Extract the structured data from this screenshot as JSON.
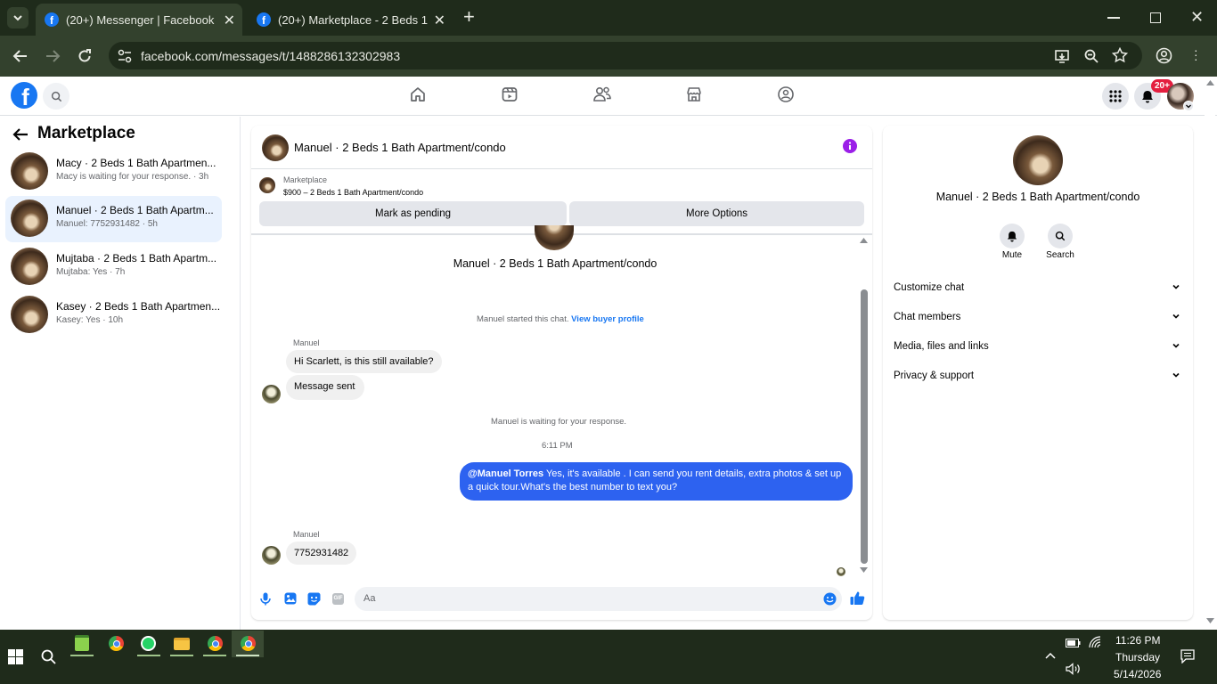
{
  "browser": {
    "tabs": [
      {
        "title": "(20+) Messenger | Facebook",
        "active": true
      },
      {
        "title": "(20+) Marketplace - 2 Beds 1 Ba",
        "active": false
      }
    ],
    "url": "facebook.com/messages/t/1488286132302983"
  },
  "fb_header": {
    "notification_badge": "20+"
  },
  "sidebar": {
    "title": "Marketplace",
    "conversations": [
      {
        "name": "Macy · 2 Beds 1 Bath Apartmen...",
        "preview": "Macy is waiting for your response. · 3h",
        "selected": false
      },
      {
        "name": "Manuel · 2 Beds 1 Bath Apartm...",
        "preview": "Manuel: 7752931482 · 5h",
        "selected": true
      },
      {
        "name": "Mujtaba · 2 Beds 1 Bath Apartm...",
        "preview": "Mujtaba: Yes · 7h",
        "selected": false
      },
      {
        "name": "Kasey · 2 Beds 1 Bath Apartmen...",
        "preview": "Kasey: Yes · 10h",
        "selected": false
      }
    ]
  },
  "chat": {
    "title": "Manuel · 2 Beds 1 Bath Apartment/condo",
    "listing_label": "Marketplace",
    "listing_detail": "$900 – 2 Beds 1 Bath Apartment/condo",
    "mark_pending": "Mark as pending",
    "more_options": "More Options",
    "thread_title": "Manuel · 2 Beds 1 Bath Apartment/condo",
    "started_text": "Manuel started this chat.",
    "view_profile": "View buyer profile",
    "sender1": "Manuel",
    "msg1": "Hi Scarlett, is this still available?",
    "msg2": "Message sent",
    "waiting": "Manuel is waiting for your response.",
    "timestamp": "6:11 PM",
    "mention": "@Manuel Torres",
    "my_message": "Yes, it's available .  I can send you rent details, extra photos & set up a quick tour.What's the best number to text you?",
    "sender2": "Manuel",
    "msg3": "7752931482",
    "composer_placeholder": "Aa"
  },
  "info_panel": {
    "title": "Manuel · 2 Beds 1 Bath Apartment/condo",
    "mute": "Mute",
    "search": "Search",
    "sections": [
      "Customize chat",
      "Chat members",
      "Media, files and links",
      "Privacy & support"
    ]
  },
  "taskbar": {
    "time": "11:26 PM",
    "day": "Thursday",
    "date": "5/14/2026"
  },
  "colors": {
    "fb_blue": "#1877f2",
    "my_bubble": "#2d62f0",
    "info_purple": "#9b1fe8",
    "chrome_dark": "#1f2b1b",
    "chrome_toolbar": "#33412d",
    "badge_red": "#e41e3f"
  }
}
